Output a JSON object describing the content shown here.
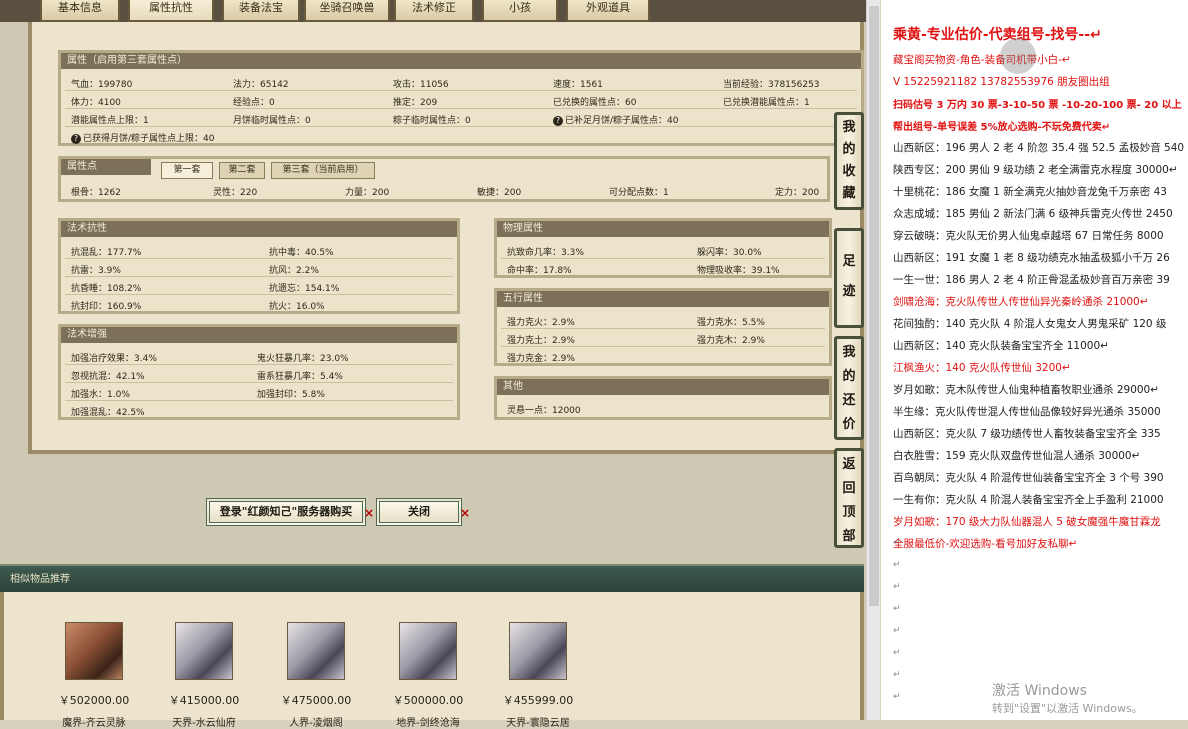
{
  "tabs": [
    "基本信息",
    "属性抗性",
    "装备法宝",
    "坐骑召唤兽",
    "法术修正",
    "小孩",
    "外观道具"
  ],
  "attr_box": {
    "header": "属性（启用第三套属性点）",
    "rows": [
      [
        "气血：199780",
        "法力：65142",
        "攻击：11056",
        "速度：1561",
        "当前经验：378156253"
      ],
      [
        "体力：4100",
        "经验点：0",
        "推定：209",
        "已兑换的属性点：60",
        "已兑换潜能属性点：1"
      ],
      [
        "潜能属性点上限：1",
        "月饼临时属性点：0",
        "粽子临时属性点：0",
        "已补足月饼/粽子属性点：40",
        ""
      ],
      [
        "已获得月饼/粽子属性点上限：40"
      ]
    ]
  },
  "points_box": {
    "header": "属性点",
    "subtabs": [
      "第一套",
      "第二套",
      "第三套（当前启用）"
    ],
    "row": [
      "根骨：1262",
      "灵性：220",
      "力量：200",
      "敏捷：200",
      "可分配点数：1",
      "定力：200"
    ]
  },
  "resist_box": {
    "header": "法术抗性",
    "rows": [
      [
        "抗混乱：177.7%",
        "抗中毒：40.5%"
      ],
      [
        "抗雷：3.9%",
        "抗风：2.2%"
      ],
      [
        "抗昏睡：108.2%",
        "抗遗忘：154.1%"
      ],
      [
        "抗封印：160.9%",
        "抗火：16.0%"
      ]
    ]
  },
  "enhance_box": {
    "header": "法术增强",
    "rows": [
      [
        "加强冶疗效果：3.4%",
        "鬼火狂暴几率：23.0%"
      ],
      [
        "忽视抗混：42.1%",
        "雷系狂暴几率：5.4%"
      ],
      [
        "加强水：1.0%",
        "加强封印：5.8%"
      ],
      [
        "加强混乱：42.5%",
        ""
      ]
    ]
  },
  "phys_box": {
    "header": "物理属性",
    "rows": [
      [
        "抗致命几率：3.3%",
        "躲闪率：30.0%"
      ],
      [
        "命中率：17.8%",
        "物理吸收率：39.1%"
      ]
    ]
  },
  "wuxing_box": {
    "header": "五行属性",
    "rows": [
      [
        "强力克火：2.9%",
        "强力克水：5.5%"
      ],
      [
        "强力克土：2.9%",
        "强力克木：2.9%"
      ],
      [
        "强力克金：2.9%",
        ""
      ]
    ]
  },
  "other_box": {
    "header": "其他",
    "rows": [
      [
        "灵悬一点：12000"
      ]
    ]
  },
  "side_buttons": [
    "我的收藏",
    "足迹",
    "我的还价",
    "返回顶部"
  ],
  "buttons": {
    "login": "登录\"红颜知己\"服务器购买",
    "close": "关闭",
    "x": "×"
  },
  "similar": {
    "header": "相似物品推荐",
    "items": [
      {
        "price": "￥502000.00",
        "name": "魔界-齐云灵脉"
      },
      {
        "price": "￥415000.00",
        "name": "天界-水云仙府"
      },
      {
        "price": "￥475000.00",
        "name": "人界-凌烟阁"
      },
      {
        "price": "￥500000.00",
        "name": "地界-剑终沧海"
      },
      {
        "price": "￥455999.00",
        "name": "天界-寰隐云居"
      }
    ]
  },
  "notes": {
    "title": "乘黄-专业估价-代卖组号-找号--↵",
    "lines": [
      {
        "t": "藏宝阁买物资-角色-装备司机带小白-↵",
        "c": "red"
      },
      {
        "t": "V 15225921182   13782553976 朋友圈出组",
        "c": "red"
      },
      {
        "t": "扫码估号 3 万内 30 票-3-10-50 票 -10-20-100 票- 20 以上",
        "c": "redbold"
      },
      {
        "t": "帮出组号-单号误差 5%放心选购-不玩免费代卖↵",
        "c": "redbold"
      },
      {
        "t": "山西新区：196 男人 2 老 4 阶忽 35.4 强 52.5 孟极妙音 540",
        "c": ""
      },
      {
        "t": "陕西专区：200 男仙 9 级功绩 2 老全满雷克水程度 30000↵",
        "c": ""
      },
      {
        "t": "十里桃花：186 女魔 1 新全满克火抽妙音龙兔千万亲密 43",
        "c": ""
      },
      {
        "t": "众志成城：185 男仙 2 新法门满 6 级神兵雷克火传世 2450",
        "c": ""
      },
      {
        "t": "穿云破晓：克火队无价男人仙鬼卓越塔 67 日常任务 8000",
        "c": ""
      },
      {
        "t": "山西新区：191 女魔 1 老 8 级功绩克水抽孟极狐小千万 26",
        "c": ""
      },
      {
        "t": "一生一世：186 男人 2 老 4 阶正骨混孟极妙音百万亲密 39",
        "c": ""
      },
      {
        "t": "剑啸沧海：克火队传世人传世仙异光秦岭通杀 21000↵",
        "c": "red"
      },
      {
        "t": "花间独酌：140 克火队 4 阶混人女鬼女人男鬼采矿 120 级",
        "c": ""
      },
      {
        "t": "山西新区：140 克火队装备宝宝齐全 11000↵",
        "c": ""
      },
      {
        "t": "江枫渔火：140 克火队传世仙 3200↵",
        "c": "red"
      },
      {
        "t": "岁月如歌：克木队传世人仙鬼种植畜牧职业通杀 29000↵",
        "c": ""
      },
      {
        "t": "半生缘：克火队传世混人传世仙品像较好异光通杀 35000",
        "c": ""
      },
      {
        "t": "山西新区：克火队 7 级功绩传世人畜牧装备宝宝齐全 335",
        "c": ""
      },
      {
        "t": "白衣胜雪：159 克火队双盘传世仙混人通杀 30000↵",
        "c": ""
      },
      {
        "t": "百鸟朝凤：克火队 4 阶混传世仙装备宝宝齐全 3 个号 390",
        "c": ""
      },
      {
        "t": "一生有你：克火队 4 阶混人装备宝宝齐全上手盈利 21000",
        "c": ""
      },
      {
        "t": "岁月如歌：170 级大力队仙器混人 5 破女魔强牛魔甘霖龙",
        "c": "red"
      },
      {
        "t": "全服最低价-欢迎选购-看号加好友私聊↵",
        "c": "red"
      }
    ],
    "returns": [
      "↵",
      "↵",
      "↵",
      "↵",
      "↵",
      "↵",
      "↵",
      "↵"
    ]
  },
  "watermark": {
    "line1": "激活 Windows",
    "line2": "转到\"设置\"以激活 Windows。"
  }
}
